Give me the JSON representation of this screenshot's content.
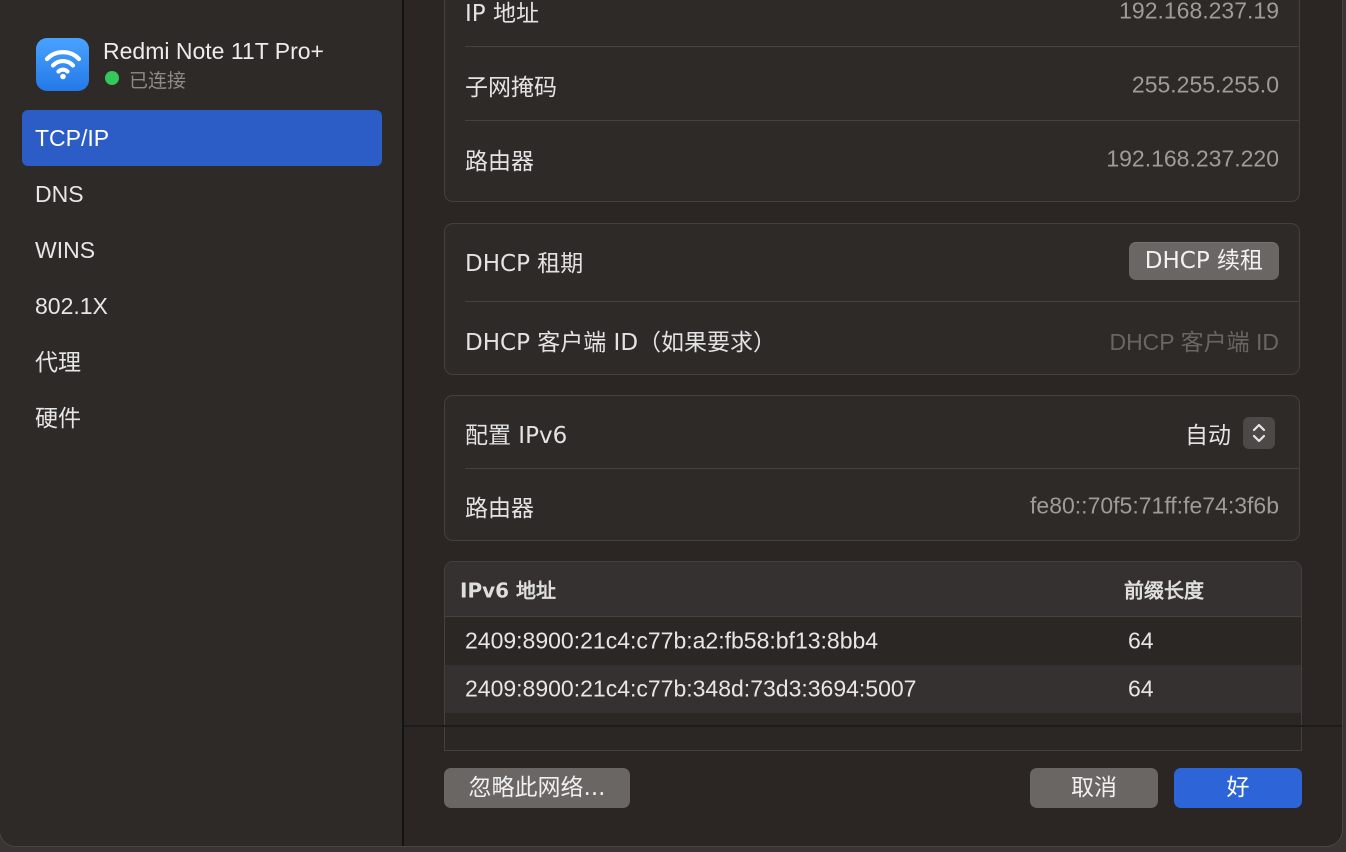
{
  "sidebar": {
    "network_name": "Redmi Note 11T Pro+",
    "status": "已连接",
    "items": [
      {
        "label": "TCP/IP"
      },
      {
        "label": "DNS"
      },
      {
        "label": "WINS"
      },
      {
        "label": "802.1X"
      },
      {
        "label": "代理"
      },
      {
        "label": "硬件"
      }
    ]
  },
  "ipv4": {
    "ip_label": "IP 地址",
    "ip_value": "192.168.237.19",
    "mask_label": "子网掩码",
    "mask_value": "255.255.255.0",
    "router_label": "路由器",
    "router_value": "192.168.237.220"
  },
  "dhcp": {
    "lease_label": "DHCP 租期",
    "renew_button": "DHCP 续租",
    "client_id_label": "DHCP 客户端 ID（如果要求）",
    "client_id_placeholder": "DHCP 客户端 ID"
  },
  "ipv6": {
    "config_label": "配置 IPv6",
    "config_value": "自动",
    "router_label": "路由器",
    "router_value": "fe80::70f5:71ff:fe74:3f6b"
  },
  "ipv6_table": {
    "headers": [
      "IPv6 地址",
      "前缀长度"
    ],
    "rows": [
      {
        "address": "2409:8900:21c4:c77b:a2:fb58:bf13:8bb4",
        "prefix": "64"
      },
      {
        "address": "2409:8900:21c4:c77b:348d:73d3:3694:5007",
        "prefix": "64"
      }
    ]
  },
  "footer": {
    "ignore_button": "忽略此网络...",
    "cancel_button": "取消",
    "ok_button": "好"
  },
  "colors": {
    "accent": "#2c5cc5",
    "primary_button": "#2d65d8",
    "status_connected": "#35c759",
    "wifi_tile": "#3b8ef5"
  }
}
